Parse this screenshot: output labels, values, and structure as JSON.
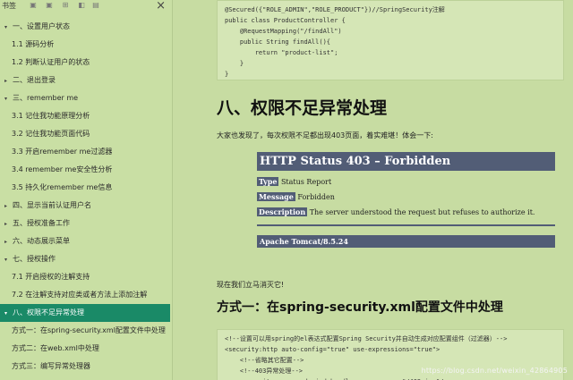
{
  "sidebar": {
    "label": "书签",
    "toc": [
      {
        "text": "一、设置用户状态",
        "level": 1,
        "caret": "▾",
        "active": false
      },
      {
        "text": "1.1 源码分析",
        "level": 2,
        "active": false
      },
      {
        "text": "1.2 判断认证用户的状态",
        "level": 2,
        "active": false
      },
      {
        "text": "二、退出登录",
        "level": 1,
        "caret": "▸",
        "active": false
      },
      {
        "text": "三、remember me",
        "level": 1,
        "caret": "▾",
        "active": false
      },
      {
        "text": "3.1 记住我功能原理分析",
        "level": 2,
        "active": false
      },
      {
        "text": "3.2 记住我功能页面代码",
        "level": 2,
        "active": false
      },
      {
        "text": "3.3 开启remember me过滤器",
        "level": 2,
        "active": false
      },
      {
        "text": "3.4 remember me安全性分析",
        "level": 2,
        "active": false
      },
      {
        "text": "3.5 持久化remember me信息",
        "level": 2,
        "active": false
      },
      {
        "text": "四、显示当前认证用户名",
        "level": 1,
        "caret": "▸",
        "active": false
      },
      {
        "text": "五、授权准备工作",
        "level": 1,
        "caret": "▸",
        "active": false
      },
      {
        "text": "六、动态展示菜单",
        "level": 1,
        "caret": "▸",
        "active": false
      },
      {
        "text": "七、授权操作",
        "level": 1,
        "caret": "▾",
        "active": false
      },
      {
        "text": "7.1 开启授权的注解支持",
        "level": 2,
        "active": false
      },
      {
        "text": "7.2 在注解支持对应类或者方法上添加注解",
        "level": 2,
        "active": false
      },
      {
        "text": "八、权限不足异常处理",
        "level": 1,
        "caret": "▾",
        "active": true
      },
      {
        "text": "方式一：在spring-security.xml配置文件中处理",
        "level": 2,
        "active": false
      },
      {
        "text": "方式二：在web.xml中处理",
        "level": 2,
        "active": false
      },
      {
        "text": "方式三：编写异常处理器",
        "level": 2,
        "active": false
      }
    ]
  },
  "code_top": [
    "@Secured({\"ROLE_ADMIN\",\"ROLE_PRODUCT\"})//SpringSecurity注解",
    "public class ProductController {",
    "    @RequestMapping(\"/findAll\")",
    "    public String findAll(){",
    "        return \"product-list\";",
    "    }",
    "}"
  ],
  "heading_eight": "八、权限不足异常处理",
  "para1": "大家也发现了，每次权限不足都出现403页面，着实难堪！体会一下:",
  "error_page": {
    "title": "HTTP Status 403 – Forbidden",
    "type_label": "Type",
    "type_value": "Status Report",
    "message_label": "Message",
    "message_value": "Forbidden",
    "description_label": "Description",
    "description_value": "The server understood the request but refuses to authorize it.",
    "footer": "Apache Tomcat/8.5.24"
  },
  "para2": "现在我们立马消灭它!",
  "heading_way1": "方式一：在spring-security.xml配置文件中处理",
  "code_bottom": [
    "<!--设置可以用spring的el表达式配置Spring Security并自动生成对应配置组件（过滤器）-->",
    "<security:http auto-config=\"true\" use-expressions=\"true\">",
    "    <!--省略其它配置-->",
    "    <!--403异常处理-->",
    "    <security:access-denied-handler error-page=\"/403.jsp\"/>"
  ],
  "watermark": "https://blog.csdn.net/weixin_42864905"
}
